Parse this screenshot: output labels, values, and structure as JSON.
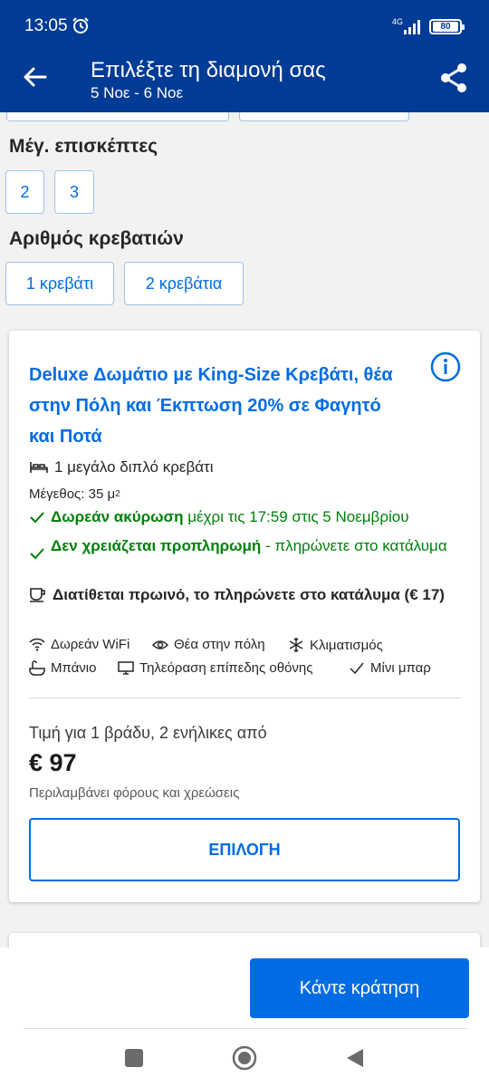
{
  "status_bar": {
    "time": "13:05",
    "network": "4G",
    "battery": "80"
  },
  "app_bar": {
    "title": "Επιλέξτε τη διαμονή σας",
    "dates": "5 Νοε - 6 Νοε"
  },
  "filters": {
    "guests_label": "Μέγ. επισκέπτες",
    "guests_options": [
      "2",
      "3"
    ],
    "beds_label": "Αριθμός κρεβατιών",
    "beds_options": [
      "1 κρεβάτι",
      "2 κρεβάτια"
    ]
  },
  "room": {
    "title": "Deluxe Δωμάτιο με King-Size Κρεβάτι, θέα στην Πόλη και Έκπτωση 20% σε Φαγητό και Ποτά",
    "bed": "1 μεγάλο διπλό κρεβάτι",
    "size_label": "Μέγεθος: 35 μ",
    "size_sup": "2",
    "cancel_bold": "Δωρεάν ακύρωση",
    "cancel_rest": " μέχρι τις 17:59 στις 5 Νοεμβρίου",
    "prepay_bold": "Δεν χρειάζεται προπληρωμή",
    "prepay_rest": " - πληρώνετε στο κατάλυμα",
    "breakfast": "Διατίθεται πρωινό, το πληρώνετε στο κατάλυμα (€ 17)",
    "facilities": [
      {
        "icon": "wifi-icon",
        "label": "Δωρεάν WiFi"
      },
      {
        "icon": "eye-icon",
        "label": "Θέα στην πόλη"
      },
      {
        "icon": "snowflake-icon",
        "label": "Κλιματισμός"
      },
      {
        "icon": "bath-icon",
        "label": "Μπάνιο"
      },
      {
        "icon": "tv-icon",
        "label": "Τηλεόραση επίπεδης οθόνης"
      },
      {
        "icon": "check-icon",
        "label": "Μίνι μπαρ"
      }
    ],
    "price_label": "Τιμή για 1 βράδυ, 2 ενήλικες από",
    "price": "€ 97",
    "tax_note": "Περιλαμβάνει φόρους και χρεώσεις",
    "select_label": "ΕΠΙΛΟΓΗ"
  },
  "bottom": {
    "book_label": "Κάντε κράτηση"
  },
  "colors": {
    "brand": "#003b95",
    "accent": "#006ce4",
    "green": "#008009"
  }
}
